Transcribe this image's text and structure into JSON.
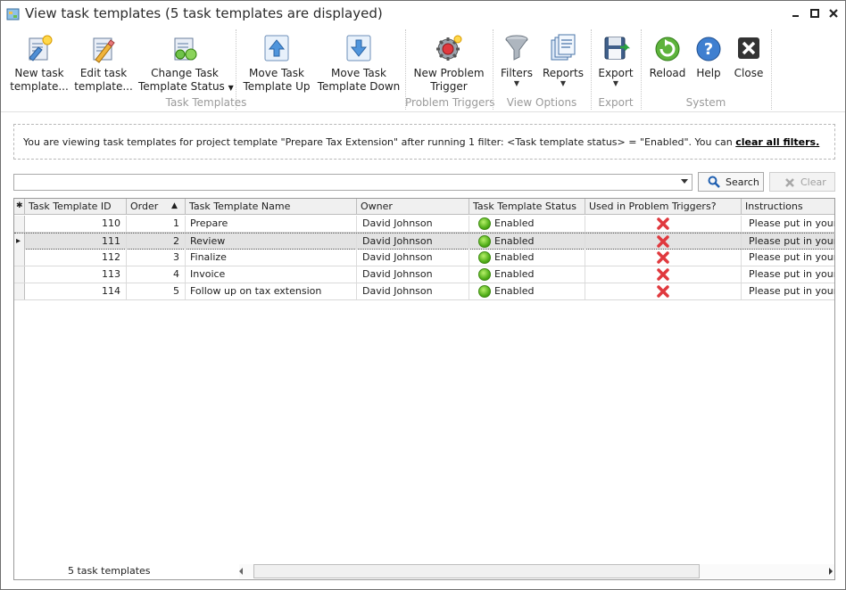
{
  "window": {
    "title": "View task templates (5 task templates are displayed)"
  },
  "ribbon": {
    "groups": {
      "task_templates": "Task Templates",
      "problem_triggers": "Problem Triggers",
      "view_options": "View Options",
      "export": "Export",
      "system": "System"
    },
    "buttons": {
      "new_task_template": [
        "New task",
        "template..."
      ],
      "edit_task_template": [
        "Edit task",
        "template..."
      ],
      "change_status": [
        "Change Task",
        "Template Status"
      ],
      "move_up": [
        "Move Task",
        "Template Up"
      ],
      "move_down": [
        "Move Task",
        "Template Down"
      ],
      "new_problem_trigger": [
        "New Problem",
        "Trigger"
      ],
      "filters": "Filters",
      "reports": "Reports",
      "export": "Export",
      "reload": "Reload",
      "help": "Help",
      "close": "Close"
    }
  },
  "filter_info": {
    "text": "You are viewing task templates for project template \"Prepare Tax Extension\" after running 1 filter: <Task template status> = \"Enabled\". You can ",
    "link": "clear all filters."
  },
  "search": {
    "value": "",
    "search_label": "Search",
    "clear_label": "Clear"
  },
  "grid": {
    "columns": [
      "Task Template ID",
      "Order",
      "Task Template Name",
      "Owner",
      "Task Template Status",
      "Used in Problem Triggers?",
      "Instructions"
    ],
    "sort_indicator": "▲",
    "new_row_marker": "✱",
    "selected_row_marker": "▸",
    "rows": [
      {
        "id": "110",
        "order": "1",
        "name": "Prepare",
        "owner": "David Johnson",
        "status": "Enabled",
        "instructions": "Please put in your tax"
      },
      {
        "id": "111",
        "order": "2",
        "name": "Review",
        "owner": "David Johnson",
        "status": "Enabled",
        "instructions": "Please put in your tax"
      },
      {
        "id": "112",
        "order": "3",
        "name": "Finalize",
        "owner": "David Johnson",
        "status": "Enabled",
        "instructions": "Please put in your tax"
      },
      {
        "id": "113",
        "order": "4",
        "name": "Invoice",
        "owner": "David Johnson",
        "status": "Enabled",
        "instructions": "Please put in your tax"
      },
      {
        "id": "114",
        "order": "5",
        "name": "Follow up on tax extension",
        "owner": "David Johnson",
        "status": "Enabled",
        "instructions": "Please put in your tax"
      }
    ],
    "footer_count": "5 task templates"
  },
  "colors": {
    "enabled_green": "#53b01a",
    "not_used_red": "#e0393e",
    "accent_blue": "#2f6fc2"
  }
}
